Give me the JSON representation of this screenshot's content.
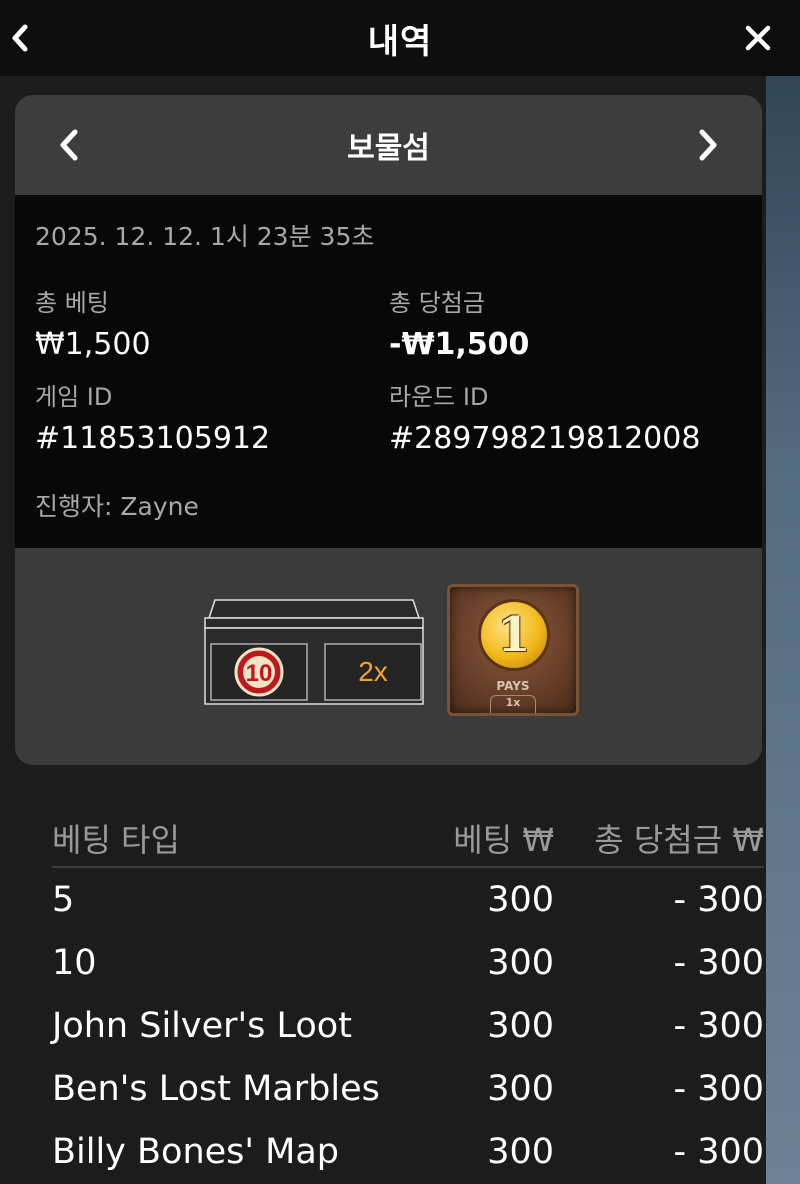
{
  "header": {
    "title": "내역",
    "back_icon": "chevron-left-icon",
    "close_icon": "close-icon"
  },
  "card": {
    "title": "보물섬",
    "datetime": "2025. 12. 12. 1시 23분 35초",
    "total_bet_label": "총 베팅",
    "total_bet_value": "₩1,500",
    "total_win_label": "총 당첨금",
    "total_win_value": "-₩1,500",
    "game_id_label": "게임 ID",
    "game_id_value": "#11853105912",
    "round_id_label": "라운드 ID",
    "round_id_value": "#289798219812008",
    "dealer": "진행자: Zayne",
    "result": {
      "chest_numbers": [
        "10",
        "2x"
      ],
      "payout_value": "1",
      "payout_label": "PAYS",
      "payout_multiplier": "1x"
    }
  },
  "table": {
    "headers": {
      "type": "베팅 타입",
      "bet": "베팅 ₩",
      "win": "총 당첨금 ₩"
    },
    "rows": [
      {
        "type": "5",
        "bet": "300",
        "win": "- 300"
      },
      {
        "type": "10",
        "bet": "300",
        "win": "- 300"
      },
      {
        "type": "John Silver's Loot",
        "bet": "300",
        "win": "- 300"
      },
      {
        "type": "Ben's Lost Marbles",
        "bet": "300",
        "win": "- 300"
      },
      {
        "type": "Billy Bones' Map",
        "bet": "300",
        "win": "- 300"
      }
    ]
  },
  "colors": {
    "background": "#1c1c1c",
    "topbar": "#0e0e0e",
    "card_header": "#3d3d3d",
    "details_bg": "#080808",
    "label": "#a8a8a8"
  }
}
